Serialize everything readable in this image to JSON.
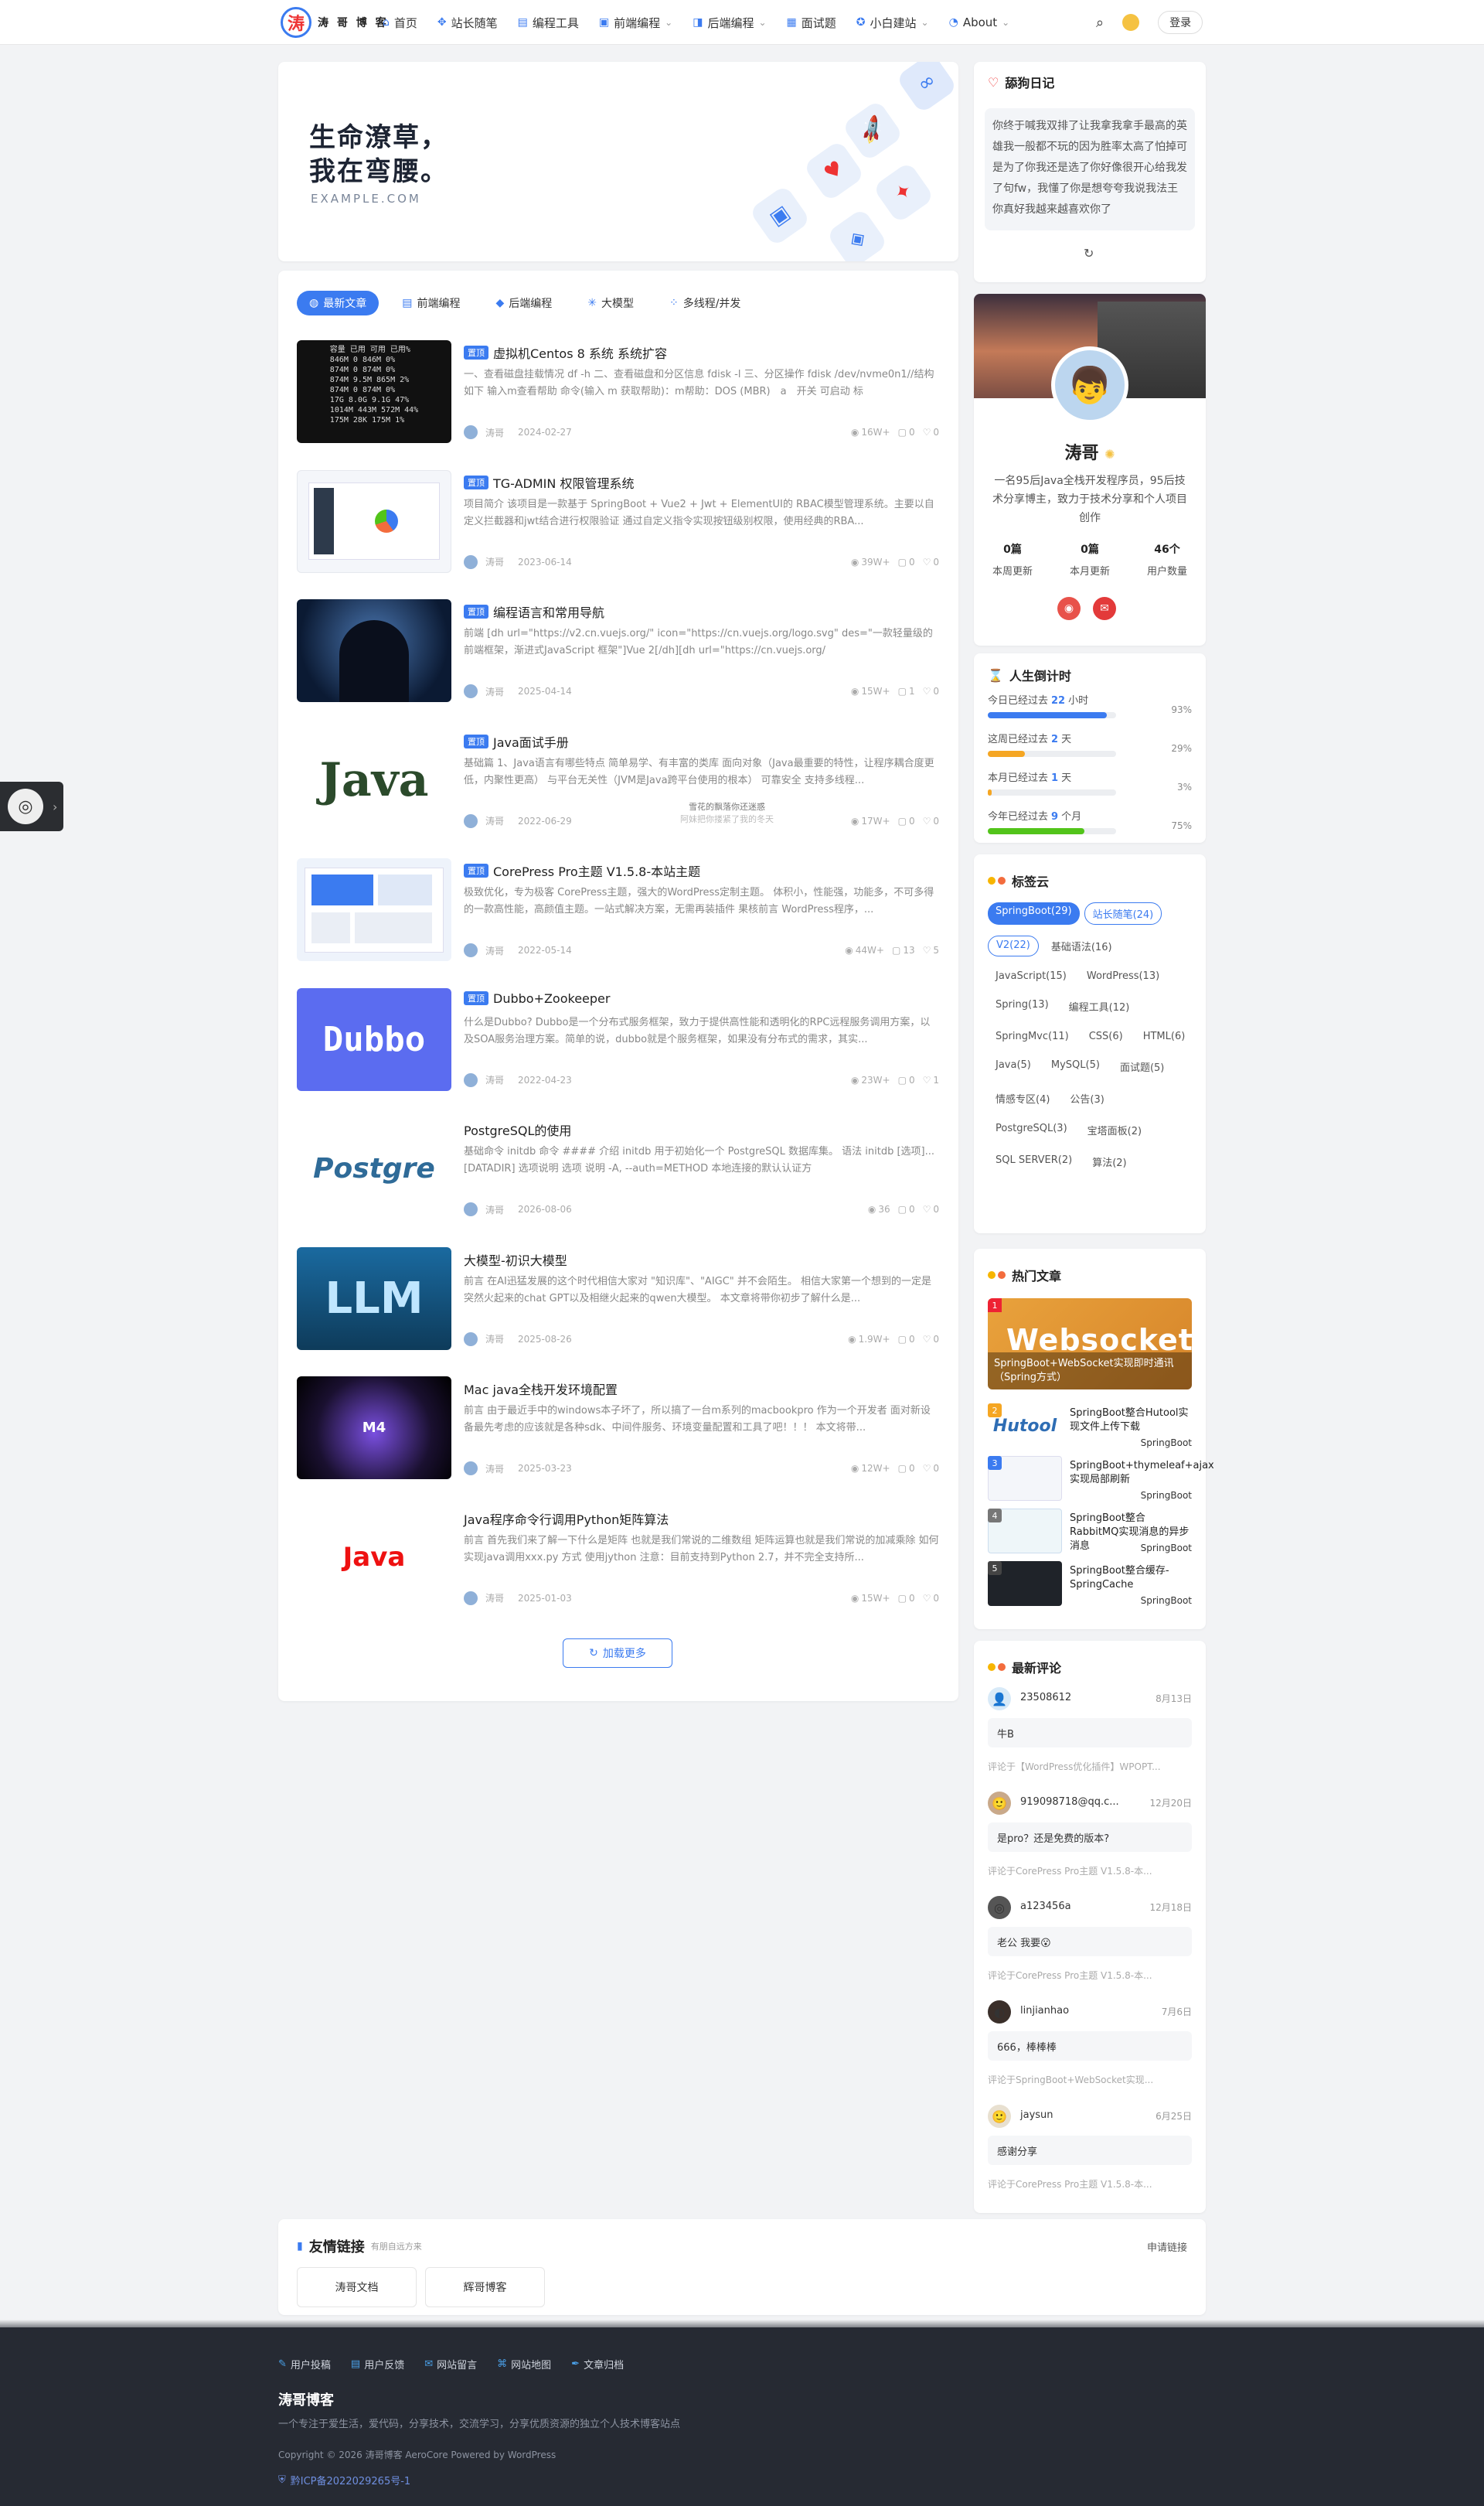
{
  "header": {
    "logo_mark": "涛",
    "logo_text": "涛 哥 博 客",
    "nav": [
      {
        "icon": "home-icon",
        "glyph": "⌂",
        "label": "首页"
      },
      {
        "icon": "compass-icon",
        "glyph": "✥",
        "label": "站长随笔"
      },
      {
        "icon": "tools-icon",
        "glyph": "▤",
        "label": "编程工具"
      },
      {
        "icon": "code-icon",
        "glyph": "▣",
        "label": "前端编程",
        "caret": "⌄"
      },
      {
        "icon": "server-icon",
        "glyph": "◨",
        "label": "后端编程",
        "caret": "⌄"
      },
      {
        "icon": "question-icon",
        "glyph": "▦",
        "label": "面试题"
      },
      {
        "icon": "rocket-icon",
        "glyph": "✪",
        "label": "小白建站",
        "caret": "⌄"
      },
      {
        "icon": "info-icon",
        "glyph": "◔",
        "label": "About",
        "caret": "⌄"
      }
    ],
    "login": "登录"
  },
  "hero": {
    "line1": "生命潦草，",
    "line2": "我在弯腰。",
    "domain": "EXAMPLE.COM"
  },
  "tabs": [
    {
      "glyph": "◍",
      "label": "最新文章",
      "active": true
    },
    {
      "glyph": "▤",
      "label": "前端编程"
    },
    {
      "glyph": "◆",
      "label": "后端编程"
    },
    {
      "glyph": "✳",
      "label": "大模型"
    },
    {
      "glyph": "⁘",
      "label": "多线程/并发"
    }
  ],
  "articles": [
    {
      "pinned": "置顶",
      "title": "虚拟机Centos 8 系统 系统扩容",
      "excerpt": "一、查看磁盘挂载情况 df -h 二、查看磁盘和分区信息 fdisk -l 三、分区操作 fdisk /dev/nvme0n1//结构如下 输入m查看帮助 命令(输入 m 获取帮助)：m帮助：DOS (MBR)　a　开关 可启动 标",
      "author": "涛哥",
      "date": "2024-02-27",
      "views": "16W+",
      "comments": "0",
      "likes": "0",
      "thumb": "terminal"
    },
    {
      "pinned": "置顶",
      "title": "TG-ADMIN 权限管理系统",
      "excerpt": "项目简介 该项目是一款基于 SpringBoot + Vue2 + Jwt + ElementUI的 RBAC模型管理系统。主要以自定义拦截器和jwt结合进行权限验证 通过自定义指令实现按钮级别权限，使用经典的RBA...",
      "author": "涛哥",
      "date": "2023-06-14",
      "views": "39W+",
      "comments": "0",
      "likes": "0",
      "thumb": "dashboard"
    },
    {
      "pinned": "置顶",
      "title": "编程语言和常用导航",
      "excerpt": "前端 [dh url=\"https://v2.cn.vuejs.org/\" icon=\"https://cn.vuejs.org/logo.svg\" des=\"一款轻量级的前端框架，渐进式JavaScript 框架\"]Vue 2[/dh][dh url=\"https://cn.vuejs.org/",
      "author": "涛哥",
      "date": "2025-04-14",
      "views": "15W+",
      "comments": "1",
      "likes": "0",
      "thumb": "hacker"
    },
    {
      "pinned": "置顶",
      "title": "Java面试手册",
      "excerpt": "基础篇 1、Java语言有哪些特点 简单易学、有丰富的类库 面向对象（Java最重要的特性，让程序耦合度更低，内聚性更高） 与平台无关性（JVM是Java跨平台使用的根本） 可靠安全 支持多线程...",
      "author": "涛哥",
      "date": "2022-06-29",
      "views": "17W+",
      "comments": "0",
      "likes": "0",
      "thumb": "wordcloud"
    },
    {
      "pinned": "置顶",
      "title": "CorePress Pro主题 V1.5.8-本站主题",
      "excerpt": "极致优化，专为极客 CorePress主题，强大的WordPress定制主题。 体积小，性能强，功能多，不可多得的一款高性能，高颜值主题。一站式解决方案，无需再装插件 果核前言 WordPress程序，...",
      "author": "涛哥",
      "date": "2022-05-14",
      "views": "44W+",
      "comments": "13",
      "likes": "5",
      "thumb": "theme"
    },
    {
      "pinned": "置顶",
      "title": "Dubbo+Zookeeper",
      "excerpt": "什么是Dubbo? Dubbo是一个分布式服务框架，致力于提供高性能和透明化的RPC远程服务调用方案，以及SOA服务治理方案。简单的说，dubbo就是个服务框架，如果没有分布式的需求，其实...",
      "author": "涛哥",
      "date": "2022-04-23",
      "views": "23W+",
      "comments": "0",
      "likes": "1",
      "thumb": "dubbo"
    },
    {
      "pinned": "",
      "title": "PostgreSQL的使用",
      "excerpt": "基础命令 initdb 命令 #### 介绍 initdb 用于初始化一个 PostgreSQL 数据库集。 语法 initdb [选项]... [DATADIR] 选项说明 选项 说明 -A, --auth=METHOD 本地连接的默认认证方",
      "author": "涛哥",
      "date": "2026-08-06",
      "views": "36",
      "comments": "0",
      "likes": "0",
      "thumb": "postgres"
    },
    {
      "pinned": "",
      "title": "大模型-初识大模型",
      "excerpt": "前言 在AI迅猛发展的这个时代相信大家对 \"知识库\"、\"AIGC\" 并不会陌生。 相信大家第一个想到的一定是突然火起来的chat GPT以及相继火起来的qwen大模型。 本文章将带你初步了解什么是...",
      "author": "涛哥",
      "date": "2025-08-26",
      "views": "1.9W+",
      "comments": "0",
      "likes": "0",
      "thumb": "llm"
    },
    {
      "pinned": "",
      "title": "Mac java全栈开发环境配置",
      "excerpt": "前言 由于最近手中的windows本子坏了，所以搞了一台m系列的macbookpro 作为一个开发者 面对新设备最先考虑的应该就是各种sdk、中间件服务、环境变量配置和工具了吧！！！ 本文将带...",
      "author": "涛哥",
      "date": "2025-03-23",
      "views": "12W+",
      "comments": "0",
      "likes": "0",
      "thumb": "mac"
    },
    {
      "pinned": "",
      "title": "Java程序命令行调用Python矩阵算法",
      "excerpt": "前言 首先我们来了解一下什么是矩阵 也就是我们常说的二维数组 矩阵运算也就是我们常说的加减乘除 如何实现java调用xxx.py 方式 使用jython 注意：目前支持到Python 2.7，并不完全支持所...",
      "author": "涛哥",
      "date": "2025-01-03",
      "views": "15W+",
      "comments": "0",
      "likes": "0",
      "thumb": "java"
    }
  ],
  "thumb_text": {
    "dubbo": "Dubbo",
    "postgres": "Postgre",
    "llm": "LLM",
    "mac": "M4",
    "java": "Java",
    "wordcloud": "Java",
    "terminal": "容量 已用 可用 已用%\n846M 0 846M 0%\n874M 0 874M 0%\n874M 9.5M 865M 2%\n874M 0 874M 0%\n17G 8.0G 9.1G 47%\n1014M 443M 572M 44%\n175M 28K 175M 1%"
  },
  "tooltip": {
    "line1": "雪花的飘落你还迷惑",
    "line2": "阿妹把你搂紧了我的冬天"
  },
  "load_more": "加载更多",
  "diary": {
    "title": "舔狗日记",
    "text": "你终于喊我双排了让我拿我拿手最高的英雄我一般都不玩的因为胜率太高了怕掉可是为了你我还是选了你好像很开心给我发了句fw，我懂了你是想夸夸我说我法王你真好我越来越喜欢你了",
    "refresh": "↻"
  },
  "profile": {
    "name": "涛哥",
    "bio": "一名95后Java全栈开发程序员，95后技术分享博主，致力于技术分享和个人项目创作",
    "stats": [
      {
        "value": "0篇",
        "label": "本周更新"
      },
      {
        "value": "0篇",
        "label": "本月更新"
      },
      {
        "value": "46个",
        "label": "用户数量"
      }
    ]
  },
  "countdown": {
    "title": "人生倒计时",
    "items": [
      {
        "prefix": "今日已经过去",
        "value": "22",
        "unit": "小时",
        "pct_label": "93%",
        "pct": 93
      },
      {
        "prefix": "这周已经过去",
        "value": "2",
        "unit": "天",
        "pct_label": "29%",
        "pct": 29
      },
      {
        "prefix": "本月已经过去",
        "value": "1",
        "unit": "天",
        "pct_label": "3%",
        "pct": 3
      },
      {
        "prefix": "今年已经过去",
        "value": "9",
        "unit": "个月",
        "pct_label": "75%",
        "pct": 75
      }
    ]
  },
  "tags": {
    "title": "标签云",
    "items": [
      "SpringBoot(29)",
      "站长随笔(24)",
      "V2(22)",
      "基础语法(16)",
      "JavaScript(15)",
      "WordPress(13)",
      "Spring(13)",
      "编程工具(12)",
      "SpringMvc(11)",
      "CSS(6)",
      "HTML(6)",
      "Java(5)",
      "MySQL(5)",
      "面试题(5)",
      "情感专区(4)",
      "公告(3)",
      "PostgreSQL(3)",
      "宝塔面板(2)",
      "SQL SERVER(2)",
      "算法(2)"
    ]
  },
  "hot": {
    "title": "热门文章",
    "banner_title": "SpringBoot+WebSocket实现即时通讯（Spring方式）",
    "banner_word": "Websocket",
    "banner_num": "1",
    "items": [
      {
        "num": "2",
        "title": "SpringBoot整合Hutool实现文件上传下载",
        "cat": "SpringBoot",
        "img": "Hutool"
      },
      {
        "num": "3",
        "title": "SpringBoot+thymeleaf+ajax实现局部刷新",
        "cat": "SpringBoot",
        "img": ""
      },
      {
        "num": "4",
        "title": "SpringBoot整合RabbitMQ实现消息的异步消息",
        "cat": "SpringBoot",
        "img": ""
      },
      {
        "num": "5",
        "title": "SpringBoot整合缓存-SpringCache",
        "cat": "SpringBoot",
        "img": ""
      }
    ]
  },
  "comments": {
    "title": "最新评论",
    "items": [
      {
        "name": "23508612",
        "date": "8月13日",
        "body": "牛B",
        "ref": "评论于【WordPress优化插件】WPOPT..."
      },
      {
        "name": "919098718@qq.c...",
        "date": "12月20日",
        "body": "是pro？还是免费的版本?",
        "ref": "评论于CorePress Pro主题 V1.5.8-本..."
      },
      {
        "name": "a123456a",
        "date": "12月18日",
        "body": "老公 我要😮",
        "ref": "评论于CorePress Pro主题 V1.5.8-本..."
      },
      {
        "name": "linjianhao",
        "date": "7月6日",
        "body": "666，棒棒棒",
        "ref": "评论于SpringBoot+WebSocket实现..."
      },
      {
        "name": "jaysun",
        "date": "6月25日",
        "body": "感谢分享",
        "ref": "评论于CorePress Pro主题 V1.5.8-本..."
      }
    ]
  },
  "friends": {
    "title": "友情链接",
    "subtitle": "有朋自远方来",
    "apply": "申请链接",
    "items": [
      "涛哥文档",
      "辉哥博客"
    ]
  },
  "footer": {
    "links": [
      "用户投稿",
      "用户反馈",
      "网站留言",
      "网站地图",
      "文章归档"
    ],
    "title": "涛哥博客",
    "desc": "一个专注于爱生活，爱代码，分享技术，交流学习，分享优质资源的独立个人技术博客站点",
    "copy": "Copyright © 2026 涛哥博客 AeroCore Powered by WordPress",
    "icp": "黔ICP备2022029265号-1"
  },
  "colors": {
    "accent": "#3b7bf0",
    "footer_bg": "#262a33"
  }
}
